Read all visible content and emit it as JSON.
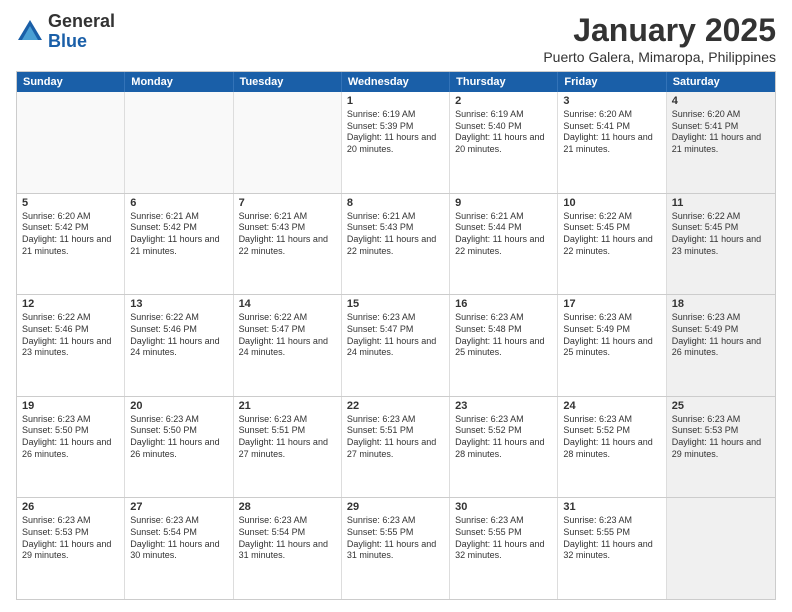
{
  "logo": {
    "general": "General",
    "blue": "Blue"
  },
  "title": "January 2025",
  "subtitle": "Puerto Galera, Mimaropa, Philippines",
  "days": [
    "Sunday",
    "Monday",
    "Tuesday",
    "Wednesday",
    "Thursday",
    "Friday",
    "Saturday"
  ],
  "weeks": [
    [
      {
        "day": "",
        "empty": true
      },
      {
        "day": "",
        "empty": true
      },
      {
        "day": "",
        "empty": true
      },
      {
        "day": "1",
        "sunrise": "6:19 AM",
        "sunset": "5:39 PM",
        "daylight": "11 hours and 20 minutes."
      },
      {
        "day": "2",
        "sunrise": "6:19 AM",
        "sunset": "5:40 PM",
        "daylight": "11 hours and 20 minutes."
      },
      {
        "day": "3",
        "sunrise": "6:20 AM",
        "sunset": "5:41 PM",
        "daylight": "11 hours and 21 minutes."
      },
      {
        "day": "4",
        "sunrise": "6:20 AM",
        "sunset": "5:41 PM",
        "daylight": "11 hours and 21 minutes.",
        "shaded": true
      }
    ],
    [
      {
        "day": "5",
        "sunrise": "6:20 AM",
        "sunset": "5:42 PM",
        "daylight": "11 hours and 21 minutes."
      },
      {
        "day": "6",
        "sunrise": "6:21 AM",
        "sunset": "5:42 PM",
        "daylight": "11 hours and 21 minutes."
      },
      {
        "day": "7",
        "sunrise": "6:21 AM",
        "sunset": "5:43 PM",
        "daylight": "11 hours and 22 minutes."
      },
      {
        "day": "8",
        "sunrise": "6:21 AM",
        "sunset": "5:43 PM",
        "daylight": "11 hours and 22 minutes."
      },
      {
        "day": "9",
        "sunrise": "6:21 AM",
        "sunset": "5:44 PM",
        "daylight": "11 hours and 22 minutes."
      },
      {
        "day": "10",
        "sunrise": "6:22 AM",
        "sunset": "5:45 PM",
        "daylight": "11 hours and 22 minutes."
      },
      {
        "day": "11",
        "sunrise": "6:22 AM",
        "sunset": "5:45 PM",
        "daylight": "11 hours and 23 minutes.",
        "shaded": true
      }
    ],
    [
      {
        "day": "12",
        "sunrise": "6:22 AM",
        "sunset": "5:46 PM",
        "daylight": "11 hours and 23 minutes."
      },
      {
        "day": "13",
        "sunrise": "6:22 AM",
        "sunset": "5:46 PM",
        "daylight": "11 hours and 24 minutes."
      },
      {
        "day": "14",
        "sunrise": "6:22 AM",
        "sunset": "5:47 PM",
        "daylight": "11 hours and 24 minutes."
      },
      {
        "day": "15",
        "sunrise": "6:23 AM",
        "sunset": "5:47 PM",
        "daylight": "11 hours and 24 minutes."
      },
      {
        "day": "16",
        "sunrise": "6:23 AM",
        "sunset": "5:48 PM",
        "daylight": "11 hours and 25 minutes."
      },
      {
        "day": "17",
        "sunrise": "6:23 AM",
        "sunset": "5:49 PM",
        "daylight": "11 hours and 25 minutes."
      },
      {
        "day": "18",
        "sunrise": "6:23 AM",
        "sunset": "5:49 PM",
        "daylight": "11 hours and 26 minutes.",
        "shaded": true
      }
    ],
    [
      {
        "day": "19",
        "sunrise": "6:23 AM",
        "sunset": "5:50 PM",
        "daylight": "11 hours and 26 minutes."
      },
      {
        "day": "20",
        "sunrise": "6:23 AM",
        "sunset": "5:50 PM",
        "daylight": "11 hours and 26 minutes."
      },
      {
        "day": "21",
        "sunrise": "6:23 AM",
        "sunset": "5:51 PM",
        "daylight": "11 hours and 27 minutes."
      },
      {
        "day": "22",
        "sunrise": "6:23 AM",
        "sunset": "5:51 PM",
        "daylight": "11 hours and 27 minutes."
      },
      {
        "day": "23",
        "sunrise": "6:23 AM",
        "sunset": "5:52 PM",
        "daylight": "11 hours and 28 minutes."
      },
      {
        "day": "24",
        "sunrise": "6:23 AM",
        "sunset": "5:52 PM",
        "daylight": "11 hours and 28 minutes."
      },
      {
        "day": "25",
        "sunrise": "6:23 AM",
        "sunset": "5:53 PM",
        "daylight": "11 hours and 29 minutes.",
        "shaded": true
      }
    ],
    [
      {
        "day": "26",
        "sunrise": "6:23 AM",
        "sunset": "5:53 PM",
        "daylight": "11 hours and 29 minutes."
      },
      {
        "day": "27",
        "sunrise": "6:23 AM",
        "sunset": "5:54 PM",
        "daylight": "11 hours and 30 minutes."
      },
      {
        "day": "28",
        "sunrise": "6:23 AM",
        "sunset": "5:54 PM",
        "daylight": "11 hours and 31 minutes."
      },
      {
        "day": "29",
        "sunrise": "6:23 AM",
        "sunset": "5:55 PM",
        "daylight": "11 hours and 31 minutes."
      },
      {
        "day": "30",
        "sunrise": "6:23 AM",
        "sunset": "5:55 PM",
        "daylight": "11 hours and 32 minutes."
      },
      {
        "day": "31",
        "sunrise": "6:23 AM",
        "sunset": "5:55 PM",
        "daylight": "11 hours and 32 minutes."
      },
      {
        "day": "",
        "empty": true,
        "shaded": true
      }
    ]
  ]
}
